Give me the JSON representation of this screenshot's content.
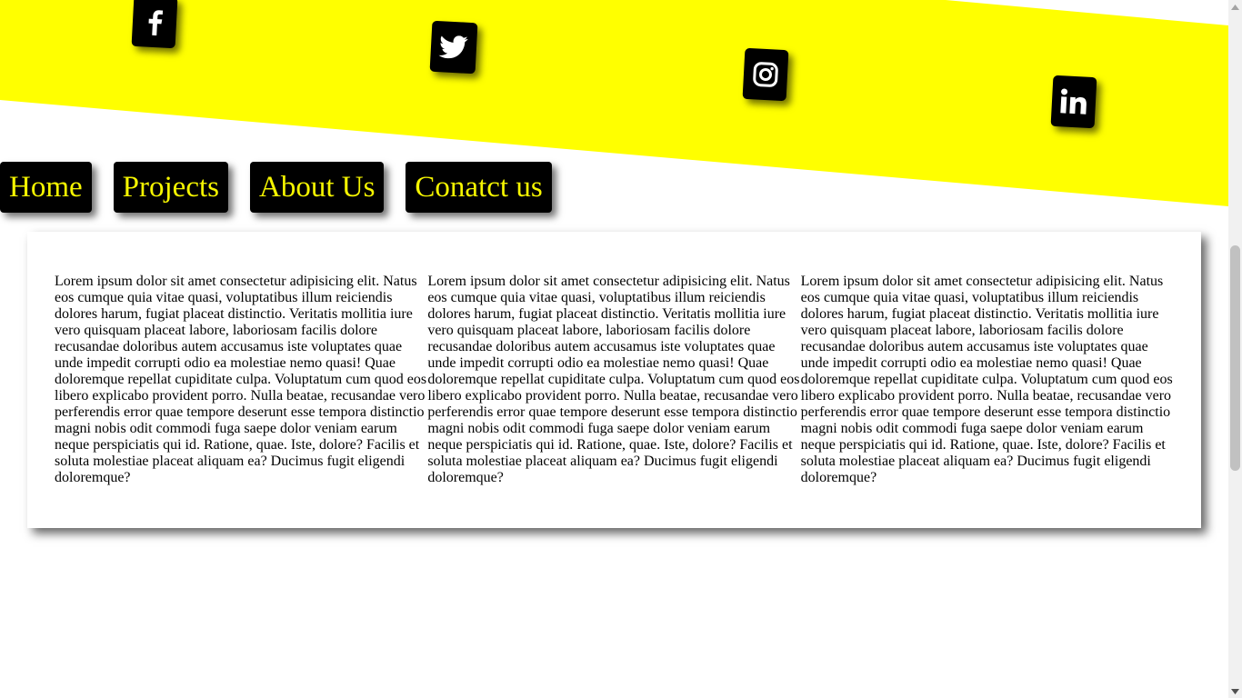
{
  "colors": {
    "banner": "#ffff00",
    "button_bg": "#000000",
    "nav_text": "#f5f500",
    "icon": "#ffffff"
  },
  "social": [
    {
      "name": "facebook",
      "icon": "facebook-icon"
    },
    {
      "name": "twitter",
      "icon": "twitter-icon"
    },
    {
      "name": "instagram",
      "icon": "instagram-icon"
    },
    {
      "name": "linkedin",
      "icon": "linkedin-icon"
    }
  ],
  "nav": {
    "home": "Home",
    "projects": "Projects",
    "about": "About Us",
    "contact": "Conatct us"
  },
  "content": {
    "columns": [
      "Lorem ipsum dolor sit amet consectetur adipisicing elit. Natus eos cumque quia vitae quasi, voluptatibus illum reiciendis dolores harum, fugiat placeat distinctio. Veritatis mollitia iure vero quisquam placeat labore, laboriosam facilis dolore recusandae doloribus autem accusamus iste voluptates quae unde impedit corrupti odio ea molestiae nemo quasi! Quae doloremque repellat cupiditate culpa. Voluptatum cum quod eos libero explicabo provident porro. Nulla beatae, recusandae vero perferendis error quae tempore deserunt esse tempora distinctio magni nobis odit commodi fuga saepe dolor veniam earum neque perspiciatis qui id. Ratione, quae. Iste, dolore? Facilis et soluta molestiae placeat aliquam ea? Ducimus fugit eligendi doloremque?",
      "Lorem ipsum dolor sit amet consectetur adipisicing elit. Natus eos cumque quia vitae quasi, voluptatibus illum reiciendis dolores harum, fugiat placeat distinctio. Veritatis mollitia iure vero quisquam placeat labore, laboriosam facilis dolore recusandae doloribus autem accusamus iste voluptates quae unde impedit corrupti odio ea molestiae nemo quasi! Quae doloremque repellat cupiditate culpa. Voluptatum cum quod eos libero explicabo provident porro. Nulla beatae, recusandae vero perferendis error quae tempore deserunt esse tempora distinctio magni nobis odit commodi fuga saepe dolor veniam earum neque perspiciatis qui id. Ratione, quae. Iste, dolore? Facilis et soluta molestiae placeat aliquam ea? Ducimus fugit eligendi doloremque?",
      "Lorem ipsum dolor sit amet consectetur adipisicing elit. Natus eos cumque quia vitae quasi, voluptatibus illum reiciendis dolores harum, fugiat placeat distinctio. Veritatis mollitia iure vero quisquam placeat labore, laboriosam facilis dolore recusandae doloribus autem accusamus iste voluptates quae unde impedit corrupti odio ea molestiae nemo quasi! Quae doloremque repellat cupiditate culpa. Voluptatum cum quod eos libero explicabo provident porro. Nulla beatae, recusandae vero perferendis error quae tempore deserunt esse tempora distinctio magni nobis odit commodi fuga saepe dolor veniam earum neque perspiciatis qui id. Ratione, quae. Iste, dolore? Facilis et soluta molestiae placeat aliquam ea? Ducimus fugit eligendi doloremque?"
    ]
  }
}
